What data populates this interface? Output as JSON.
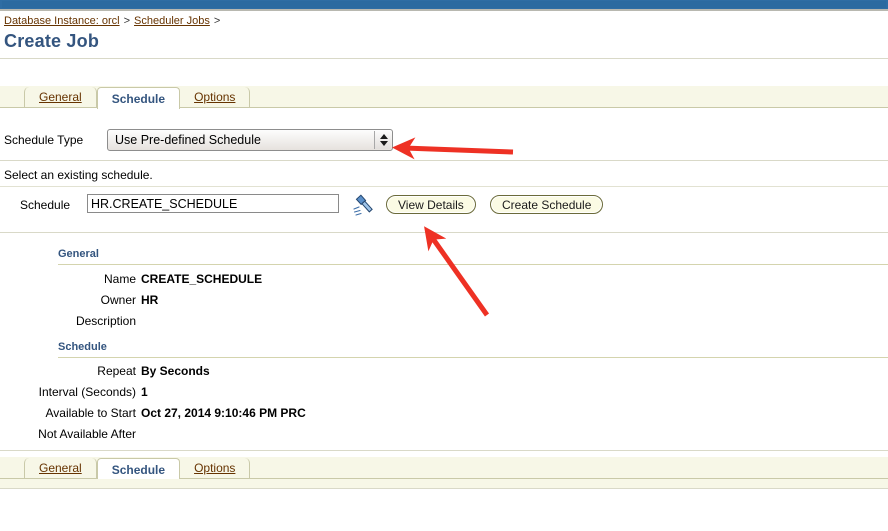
{
  "colors": {
    "topbar_blue": "#2e6da4",
    "link_brown": "#663300",
    "heading_blue": "#34557f",
    "tabbar_cream": "#f7f7e7",
    "button_cream": "#fbfbe4",
    "annotation_red": "#ee3124"
  },
  "breadcrumb": {
    "items": [
      {
        "label": "Database Instance: orcl",
        "separator": ">"
      },
      {
        "label": "Scheduler Jobs",
        "separator": ">"
      }
    ]
  },
  "page": {
    "title": "Create Job"
  },
  "tabs_top": {
    "items": [
      {
        "label": "General",
        "active": false
      },
      {
        "label": "Schedule",
        "active": true
      },
      {
        "label": "Options",
        "active": false
      }
    ]
  },
  "tabs_bottom": {
    "items": [
      {
        "label": "General",
        "active": false
      },
      {
        "label": "Schedule",
        "active": true
      },
      {
        "label": "Options",
        "active": false
      }
    ]
  },
  "form": {
    "schedule_type_label": "Schedule Type",
    "schedule_type_value": "Use Pre-defined Schedule",
    "schedule_type_options": [
      "Use Pre-defined Schedule"
    ],
    "hint": "Select an existing schedule.",
    "schedule_label": "Schedule",
    "schedule_value": "HR.CREATE_SCHEDULE",
    "schedule_placeholder": "",
    "flashlight_icon": "flashlight-search-icon",
    "view_details_label": "View Details",
    "create_schedule_label": "Create Schedule"
  },
  "details": {
    "general": {
      "heading": "General",
      "rows": [
        {
          "key": "Name",
          "value": "CREATE_SCHEDULE"
        },
        {
          "key": "Owner",
          "value": "HR"
        },
        {
          "key": "Description",
          "value": ""
        }
      ]
    },
    "schedule": {
      "heading": "Schedule",
      "rows": [
        {
          "key": "Repeat",
          "value": "By Seconds"
        },
        {
          "key": "Interval (Seconds)",
          "value": "1"
        },
        {
          "key": "Available to Start",
          "value": "Oct 27, 2014 9:10:46 PM PRC"
        },
        {
          "key": "Not Available After",
          "value": ""
        }
      ]
    }
  },
  "annotations": [
    {
      "name": "arrow-to-schedule-type-dropdown",
      "direction": "left"
    },
    {
      "name": "arrow-to-view-details-button",
      "direction": "up-left"
    }
  ]
}
